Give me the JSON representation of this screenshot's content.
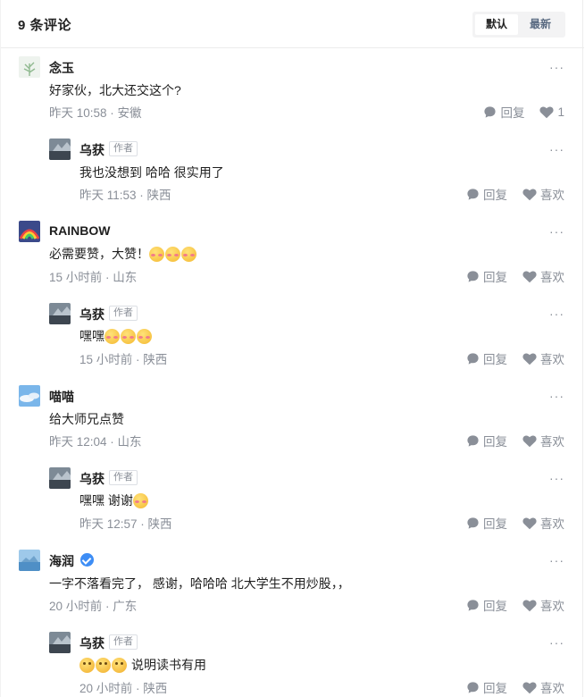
{
  "header": {
    "title": "9 条评论",
    "sort_default": "默认",
    "sort_latest": "最新"
  },
  "labels": {
    "reply": "回复",
    "like": "喜欢",
    "author_tag": "作者",
    "more": "···"
  },
  "comments": [
    {
      "name": "念玉",
      "text": "好家伙，北大还交这个?",
      "time": "昨天 10:58",
      "location": "安徽",
      "likes": "1"
    },
    {
      "name": "乌获",
      "text": "我也没想到 哈哈 很实用了",
      "time": "昨天 11:53",
      "location": "陕西"
    },
    {
      "name": "RAINBOW",
      "text": "必需要赞，大赞！",
      "time": "15 小时前",
      "location": "山东"
    },
    {
      "name": "乌获",
      "text": "嘿嘿",
      "time": "15 小时前",
      "location": "陕西"
    },
    {
      "name": "喵喵",
      "text": "给大师兄点赞",
      "time": "昨天 12:04",
      "location": "山东"
    },
    {
      "name": "乌获",
      "text": "嘿嘿 谢谢",
      "time": "昨天 12:57",
      "location": "陕西"
    },
    {
      "name": "海润",
      "text": "一字不落看完了， 感谢，哈哈哈 北大学生不用炒股，，",
      "time": "20 小时前",
      "location": "广东"
    },
    {
      "name": "乌获",
      "text": "说明读书有用",
      "time": "20 小时前",
      "location": "陕西"
    }
  ],
  "colors": {
    "accent_blue": "#3d8df5",
    "muted": "#8a8f98",
    "text": "#1f1f1f"
  }
}
